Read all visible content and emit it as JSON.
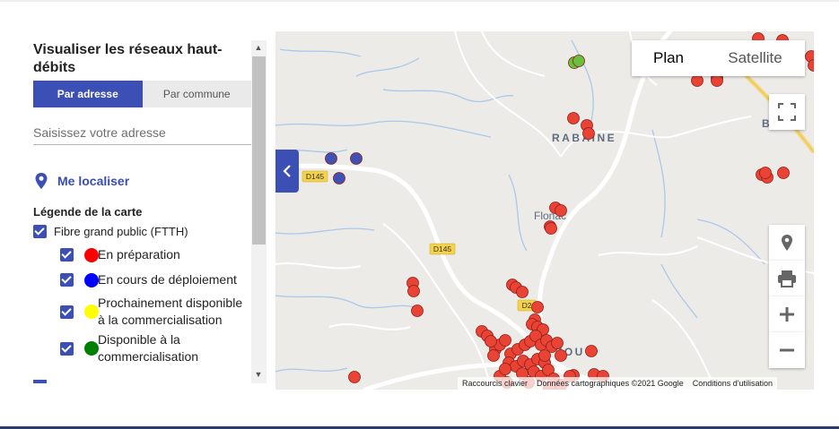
{
  "panel": {
    "title": "Visualiser les réseaux haut-débits",
    "tabs": [
      {
        "label": "Par adresse",
        "active": true
      },
      {
        "label": "Par commune",
        "active": false
      }
    ],
    "address_placeholder": "Saisissez votre adresse",
    "locate_label": "Me localiser",
    "legend_title": "Légende de la carte",
    "ftth": {
      "label": "Fibre grand public (FTTH)",
      "checked": true
    },
    "legend_items": [
      {
        "label": "En préparation",
        "color": "#ff0000",
        "checked": true
      },
      {
        "label": "En cours de déploiement",
        "color": "#0000ff",
        "checked": true
      },
      {
        "label": "Prochainement disponible à la commercialisation",
        "color": "#ffff00",
        "checked": true
      },
      {
        "label": "Disponible à la commercialisation",
        "color": "#008000",
        "checked": true
      }
    ]
  },
  "map": {
    "type_controls": {
      "plan": "Plan",
      "satellite": "Satellite",
      "selected": "Plan"
    },
    "places": [
      "RABAINE",
      "Flonac",
      "B",
      "ZOU"
    ],
    "road_labels": [
      "D145",
      "D145",
      "D2"
    ],
    "attribution": {
      "shortcuts": "Raccourcis clavier",
      "data": "Données cartographiques ©2021 Google",
      "terms": "Conditions d'utilisation"
    },
    "controls": [
      "fullscreen-icon",
      "pegman-icon",
      "print-icon",
      "zoom-in-icon",
      "zoom-out-icon"
    ],
    "marker_colors": {
      "red": "#ea4335",
      "blue": "#3f51b5",
      "green": "#6abf3f"
    }
  }
}
